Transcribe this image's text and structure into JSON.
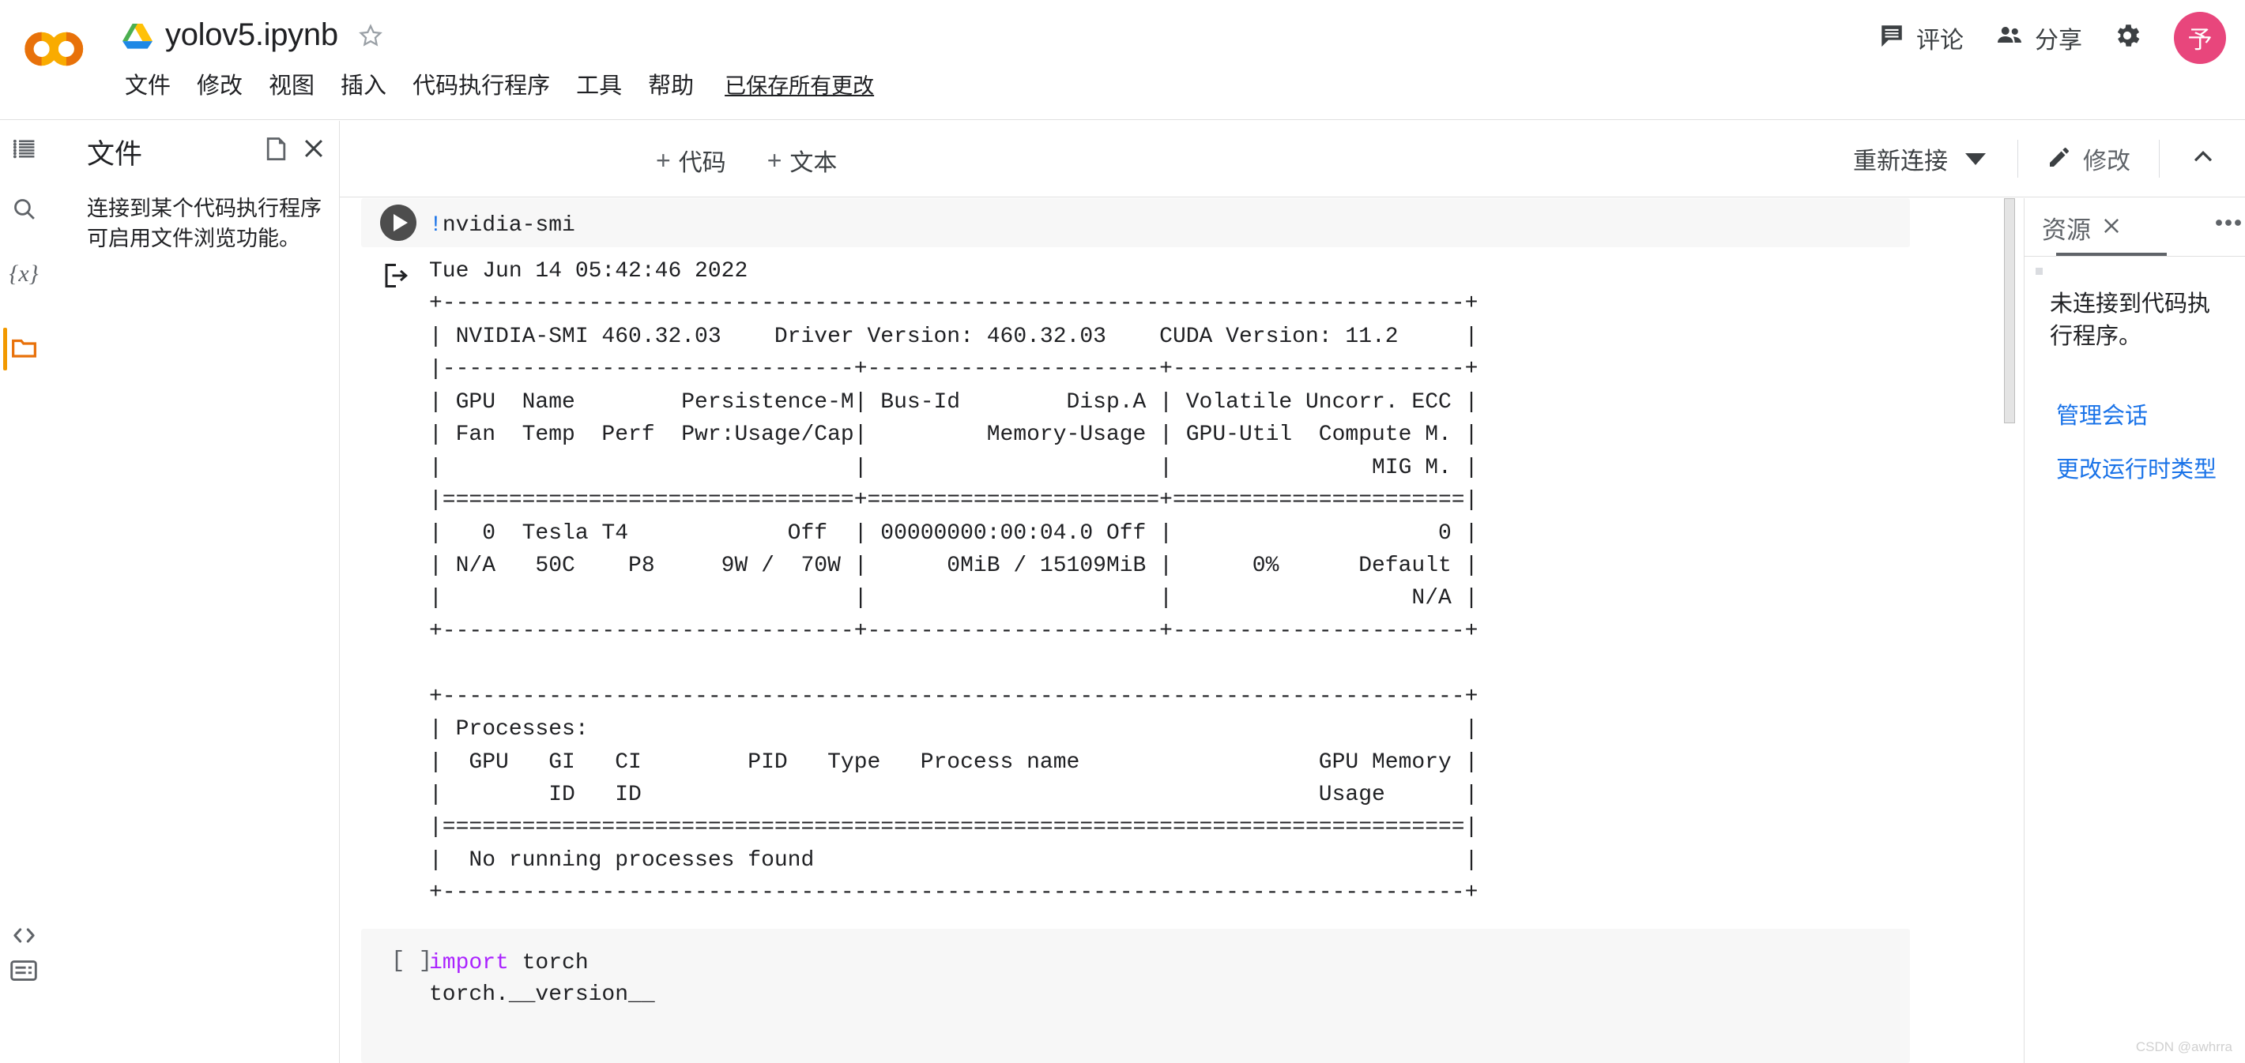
{
  "header": {
    "logo_name": "colab-logo",
    "doc_title": "yolov5.ipynb",
    "star_icon": "star-outline-icon",
    "drive_icon": "google-drive-icon",
    "menu": [
      "文件",
      "修改",
      "视图",
      "插入",
      "代码执行程序",
      "工具",
      "帮助"
    ],
    "saved_status": "已保存所有更改",
    "comment_label": "评论",
    "comment_icon": "comment-icon",
    "share_label": "分享",
    "share_icon": "people-icon",
    "settings_icon": "gear-icon",
    "avatar_initial": "予",
    "avatar_color": "#e8467c"
  },
  "toolbar": {
    "add_code_label": "代码",
    "add_text_label": "文本",
    "plus_glyph": "+",
    "reconnect_label": "重新连接",
    "reconnect_caret_icon": "chevron-down-icon",
    "edit_label": "修改",
    "edit_icon": "pencil-icon",
    "collapse_icon": "chevron-up-icon"
  },
  "rail": {
    "items": [
      {
        "name": "table-of-contents-icon",
        "label": "目录",
        "active": false
      },
      {
        "name": "search-icon",
        "label": "查找和替换",
        "active": false
      },
      {
        "name": "variables-icon",
        "label": "变量",
        "active": false
      },
      {
        "name": "folder-icon",
        "label": "文件",
        "active": true
      }
    ],
    "bottom_items": [
      {
        "name": "code-snippets-icon",
        "label": "代码段"
      },
      {
        "name": "terminal-icon",
        "label": "终端"
      }
    ],
    "active_color": "#f29900"
  },
  "sidebar": {
    "title": "文件",
    "list_icon": "list-icon",
    "new_file_icon": "new-file-icon",
    "close_icon": "close-icon",
    "message": "连接到某个代码执行程序可启用文件浏览功能。"
  },
  "notebook": {
    "cells": [
      {
        "type": "code",
        "prompt": "run",
        "run_icon": "play-button-icon",
        "source": "!nvidia-smi",
        "source_prefix": "!",
        "source_rest": "nvidia-smi",
        "output_icon": "output-arrow-icon",
        "output": "Tue Jun 14 05:42:46 2022       \n+-----------------------------------------------------------------------------+\n| NVIDIA-SMI 460.32.03    Driver Version: 460.32.03    CUDA Version: 11.2     |\n|-------------------------------+----------------------+----------------------+\n| GPU  Name        Persistence-M| Bus-Id        Disp.A | Volatile Uncorr. ECC |\n| Fan  Temp  Perf  Pwr:Usage/Cap|         Memory-Usage | GPU-Util  Compute M. |\n|                               |                      |               MIG M. |\n|===============================+======================+======================|\n|   0  Tesla T4            Off  | 00000000:00:04.0 Off |                    0 |\n| N/A   50C    P8     9W /  70W |      0MiB / 15109MiB |      0%      Default |\n|                               |                      |                  N/A |\n+-------------------------------+----------------------+----------------------+\n                                                                               \n+-----------------------------------------------------------------------------+\n| Processes:                                                                  |\n|  GPU   GI   CI        PID   Type   Process name                  GPU Memory |\n|        ID   ID                                                   Usage      |\n|=============================================================================|\n|  No running processes found                                                 |\n+-----------------------------------------------------------------------------+"
      },
      {
        "type": "code",
        "prompt": "[ ]",
        "source_line1_kw": "import",
        "source_line1_rest": " torch",
        "source_line2": "torch.__version__"
      }
    ]
  },
  "right_panel": {
    "tab_label": "资源",
    "tab_close_icon": "close-icon",
    "more_icon": "more-options-icon",
    "message": "未连接到代码执行程序。",
    "links": [
      "管理会话",
      "更改运行时类型"
    ],
    "link_color": "#1a73e8"
  },
  "watermark": "CSDN @awhrra"
}
